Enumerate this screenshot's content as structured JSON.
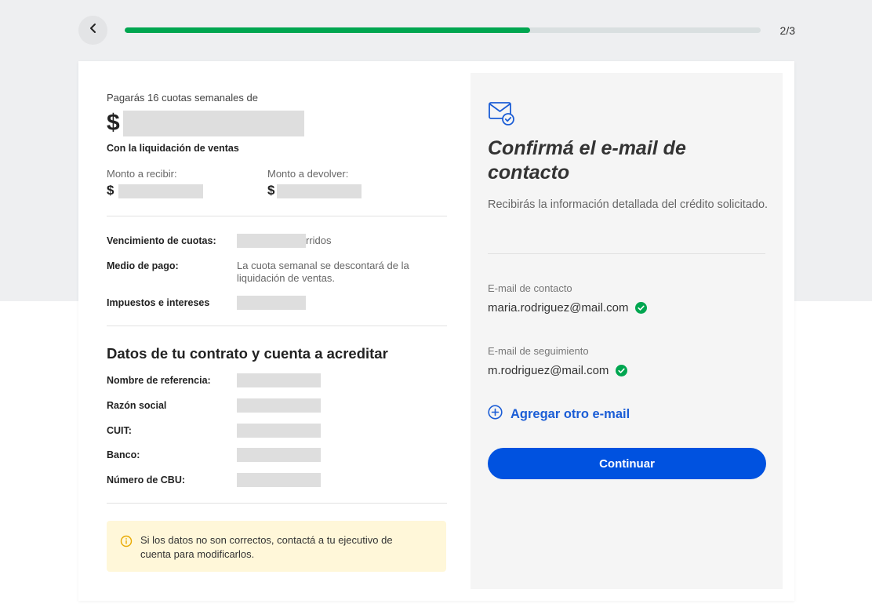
{
  "colors": {
    "progress": "#00a650",
    "primary": "#0052e0",
    "link": "#1b5dd6",
    "success": "#00a650",
    "warning_icon": "#e8a900",
    "alert_bg": "#fff7d9"
  },
  "progress": {
    "fraction": 0.637,
    "counter": "2/3"
  },
  "icons": {
    "back": "chevron-left-icon",
    "mail": "mail-check-icon",
    "check": "check-circle-icon",
    "add": "plus-circle-icon",
    "info": "info-icon"
  },
  "summary": {
    "lead": "Pagarás 16 cuotas semanales de",
    "currency": "$",
    "subtitle": "Con la liquidación de ventas",
    "receive_label": "Monto a recibir:",
    "return_label": "Monto a devolver:"
  },
  "details": {
    "due_label": "Vencimiento de cuotas:",
    "due_suffix": "rridos",
    "payment_label": "Medio de pago:",
    "payment_value": "La cuota semanal se descontará de la liquidación de ventas.",
    "taxes_label": "Impuestos e intereses"
  },
  "contract": {
    "title": "Datos de tu contrato y cuenta a acreditar",
    "fields": [
      "Nombre de referencia:",
      "Razón social",
      "CUIT:",
      "Banco:",
      "Número de CBU:"
    ]
  },
  "alert": {
    "text": "Si los datos no son correctos, contactá a tu ejecutivo de cuenta para modificarlos."
  },
  "confirm": {
    "title": "Confirmá el e-mail de contacto",
    "description": "Recibirás la información detallada del crédito solicitado.",
    "contact_label": "E-mail de contacto",
    "contact_email": "maria.rodriguez@mail.com",
    "followup_label": "E-mail de seguimiento",
    "followup_email": "m.rodriguez@mail.com",
    "add_link": "Agregar otro e-mail",
    "continue": "Continuar"
  }
}
